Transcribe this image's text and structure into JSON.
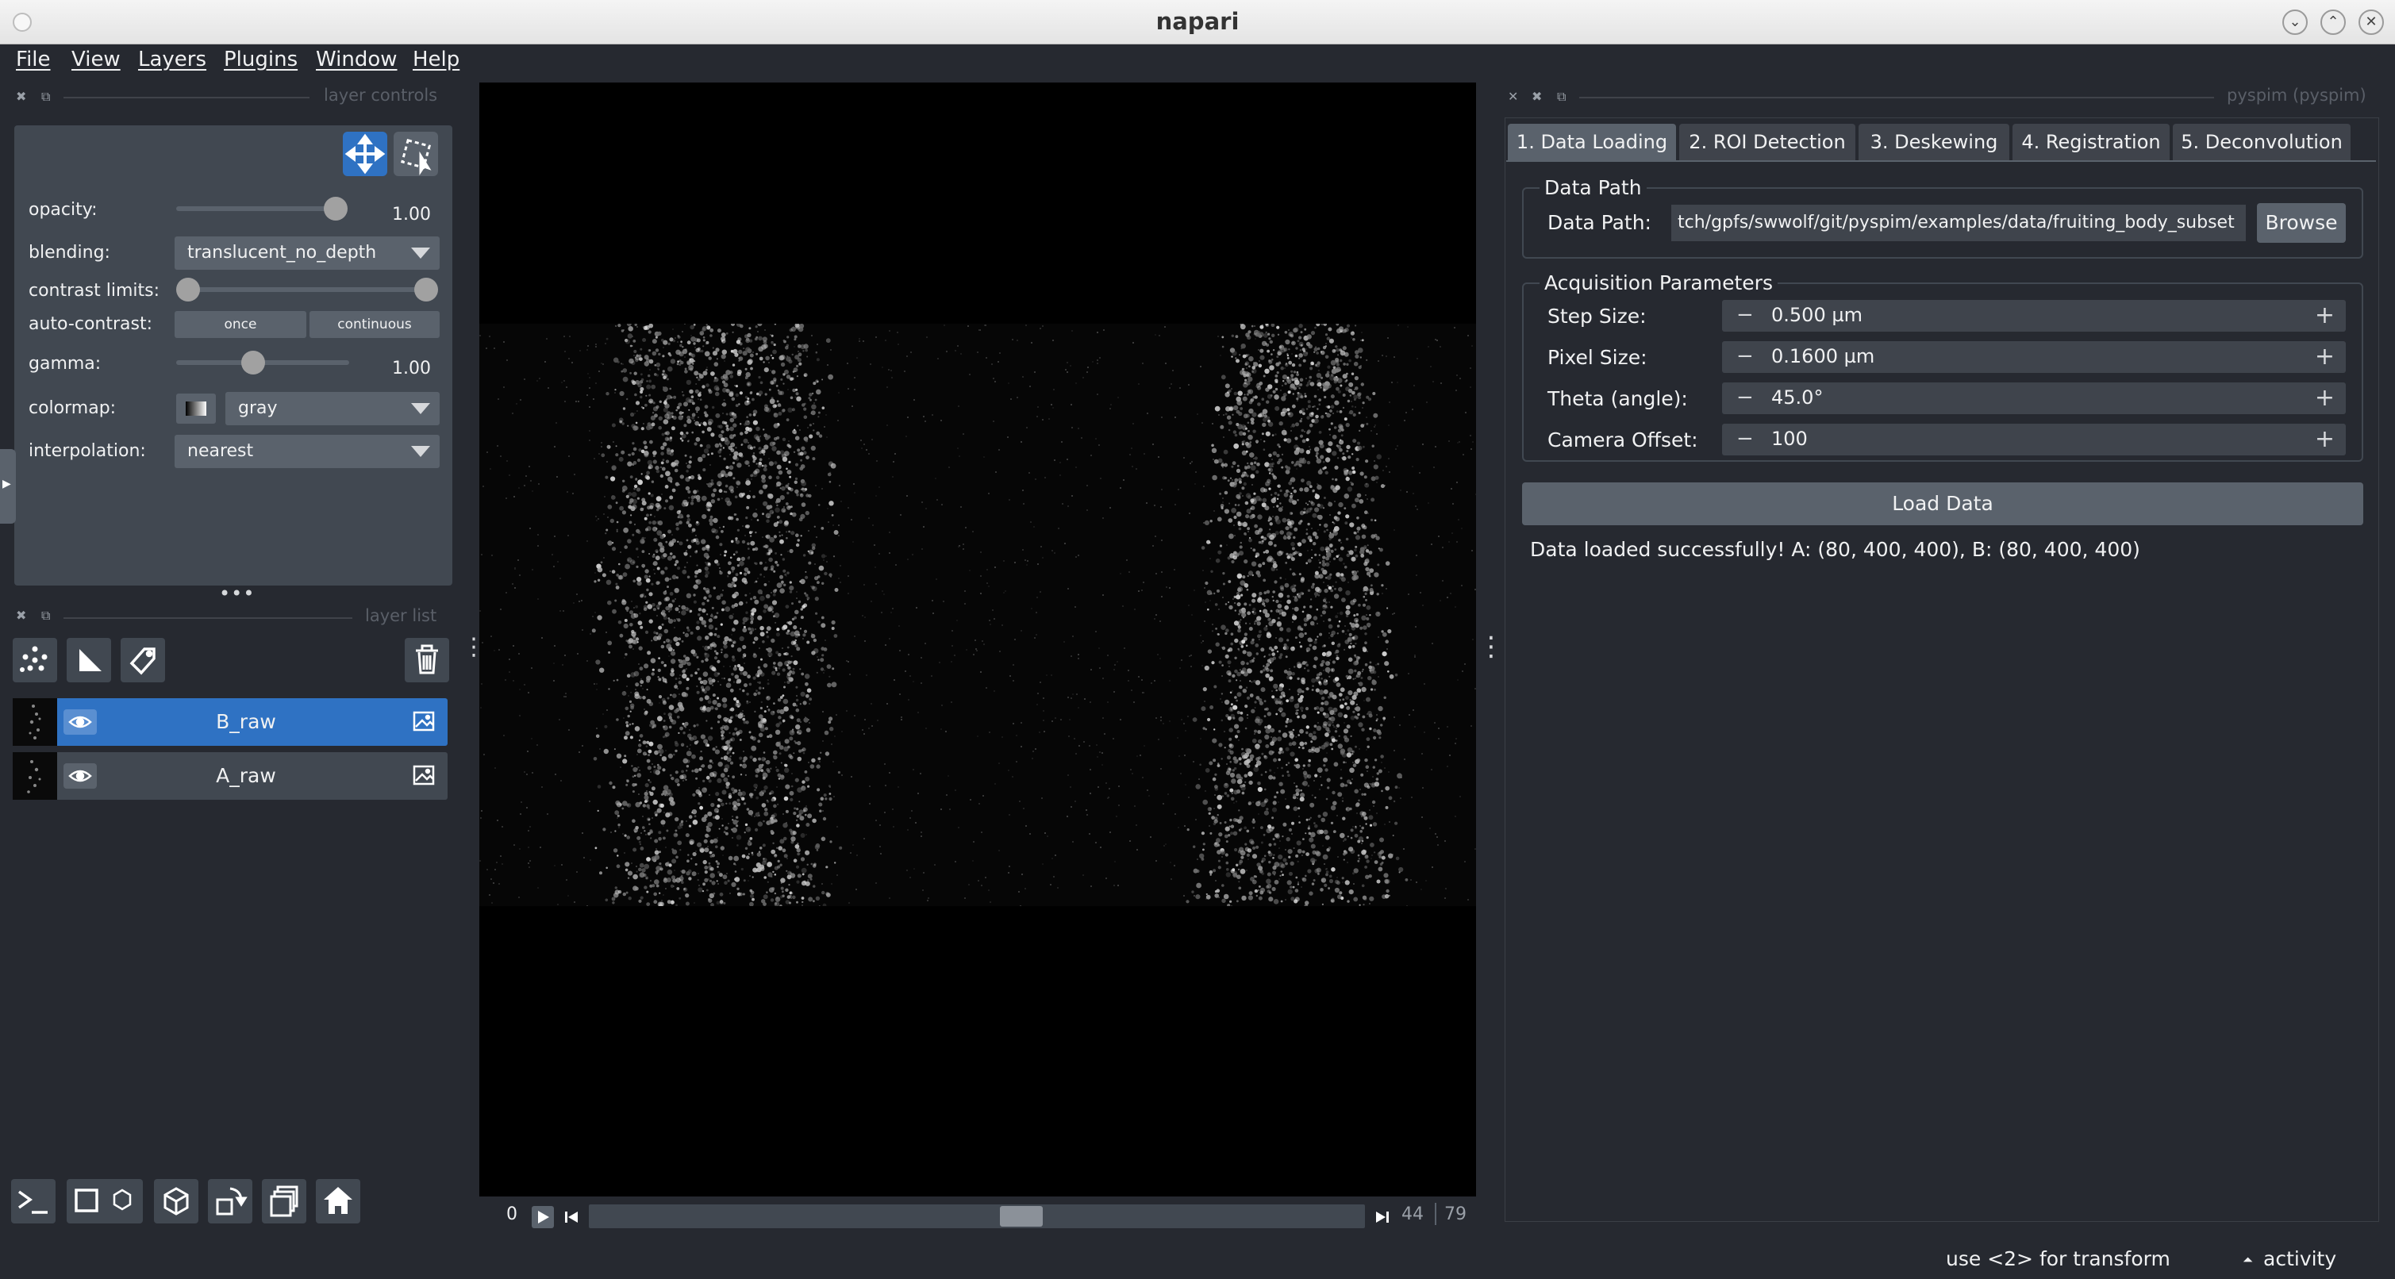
{
  "window": {
    "title": "napari"
  },
  "menubar": {
    "items": [
      "File",
      "View",
      "Layers",
      "Plugins",
      "Window",
      "Help"
    ]
  },
  "layer_controls": {
    "dock_title": "layer controls",
    "opacity": {
      "label": "opacity:",
      "value": "1.00",
      "level": 1.0
    },
    "blending": {
      "label": "blending:",
      "value": "translucent_no_depth"
    },
    "contrast_limits": {
      "label": "contrast limits:"
    },
    "auto_contrast": {
      "label": "auto-contrast:",
      "once": "once",
      "continuous": "continuous"
    },
    "gamma": {
      "label": "gamma:",
      "value": "1.00"
    },
    "colormap": {
      "label": "colormap:",
      "value": "gray"
    },
    "interpolation": {
      "label": "interpolation:",
      "value": "nearest"
    }
  },
  "layer_list": {
    "dock_title": "layer list",
    "layers": [
      {
        "name": "B_raw",
        "selected": true
      },
      {
        "name": "A_raw",
        "selected": false
      }
    ]
  },
  "dims": {
    "start": "0",
    "current": "44",
    "max": "79"
  },
  "plugin": {
    "dock_title": "pyspim (pyspim)",
    "tabs": [
      "1. Data Loading",
      "2. ROI Detection",
      "3. Deskewing",
      "4. Registration",
      "5. Deconvolution"
    ],
    "data_path_group": {
      "title": "Data Path",
      "label": "Data Path:",
      "value": "tch/gpfs/swwolf/git/pyspim/examples/data/fruiting_body_subset",
      "browse": "Browse"
    },
    "acq_group": {
      "title": "Acquisition Parameters",
      "fields": [
        {
          "label": "Step Size:",
          "value": "0.500 µm"
        },
        {
          "label": "Pixel Size:",
          "value": "0.1600 µm"
        },
        {
          "label": "Theta (angle):",
          "value": "45.0°"
        },
        {
          "label": "Camera Offset:",
          "value": "100"
        }
      ]
    },
    "load_button": "Load Data",
    "status": "Data loaded successfully! A: (80, 400, 400), B: (80, 400, 400)"
  },
  "statusbar": {
    "hint": "use <2> for transform",
    "activity": "activity"
  },
  "colors": {
    "accent": "#2f72c3",
    "panel": "#414851",
    "background": "#262930",
    "control": "#5a626c"
  }
}
